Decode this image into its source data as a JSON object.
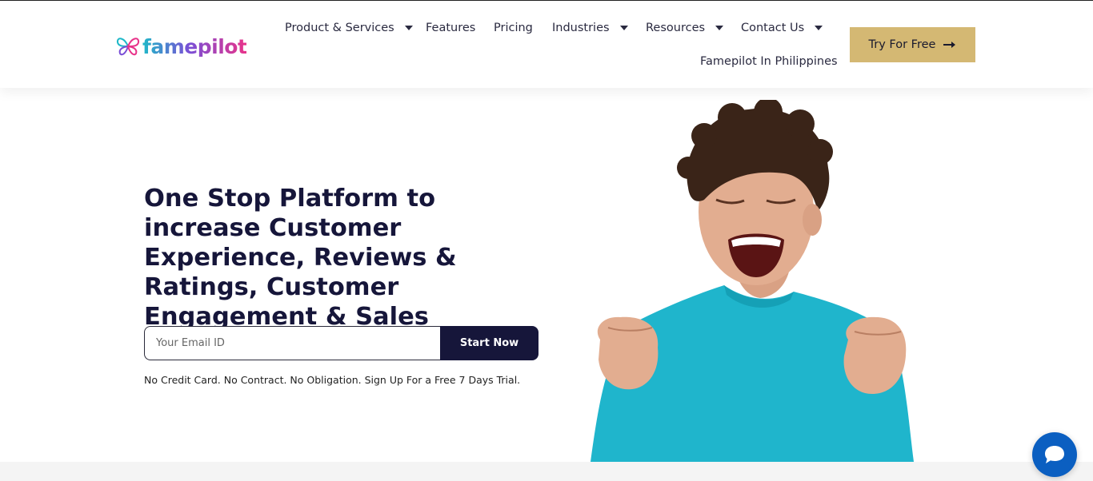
{
  "brand": {
    "name": "famepilot",
    "gradient": [
      "#1fb8c8",
      "#7a4fd6",
      "#e8338a"
    ]
  },
  "nav": {
    "items": [
      {
        "label": "Product & Services",
        "has_dropdown": true
      },
      {
        "label": "Features",
        "has_dropdown": false
      },
      {
        "label": "Pricing",
        "has_dropdown": false
      },
      {
        "label": "Industries",
        "has_dropdown": true
      },
      {
        "label": "Resources",
        "has_dropdown": true
      },
      {
        "label": "Contact Us",
        "has_dropdown": true
      },
      {
        "label": "Famepilot In Philippines",
        "has_dropdown": false
      }
    ],
    "cta": {
      "label": "Try For Free",
      "icon": "arrow-right-icon",
      "color": "#d4b873"
    }
  },
  "hero": {
    "title": "One Stop Platform to increase Customer Experience, Reviews & Ratings, Customer Engagement & Sales",
    "email_placeholder": "Your Email ID",
    "submit_label": "Start Now",
    "disclaimer": "No Credit Card. No Contract. No Obligation. Sign Up For a Free 7 Days Trial.",
    "image": "excited-man-teal-shirt-photo"
  },
  "chat": {
    "icon": "chat-bubble-icon",
    "color": "#0b5fc1"
  },
  "colors": {
    "primary_dark": "#16163a",
    "cta_gold": "#d4b873",
    "shirt_teal": "#1fb5cc"
  }
}
